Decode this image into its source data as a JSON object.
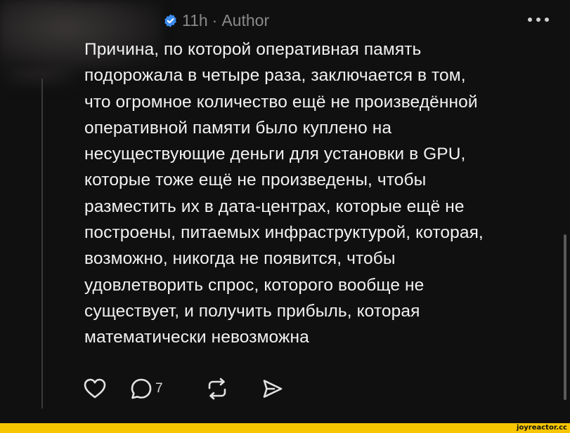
{
  "meta": {
    "time": "11h",
    "separator": "·",
    "role": "Author"
  },
  "post": {
    "lines": [
      "Причина, по которой оперативная память",
      "подорожала в четыре раза, заключается в том,",
      "что огромное количество ещё не произведённой",
      "оперативной памяти было куплено на",
      "несуществующие деньги для установки в GPU,",
      "которые тоже ещё не произведены, чтобы",
      "разместить их в дата-центрах, которые ещё не",
      "построены, питаемых инфраструктурой, которая,",
      "возможно, никогда не появится, чтобы",
      "удовлетворить спрос, которого вообще не",
      "существует, и получить прибыль, которая",
      "математически невозможна"
    ]
  },
  "actions": {
    "reply_count": "7"
  },
  "icons": {
    "verified": "verified-badge-icon",
    "more": "more-icon",
    "like": "heart-icon",
    "reply": "comment-icon",
    "repost": "repost-icon",
    "share": "send-icon"
  },
  "colors": {
    "background": "#101010",
    "text": "#f2f2f2",
    "muted": "#8a8a8a",
    "verified": "#3b8cf0",
    "watermark_bg": "#f7c600"
  },
  "watermark": {
    "text": "joyreactor.cc"
  }
}
